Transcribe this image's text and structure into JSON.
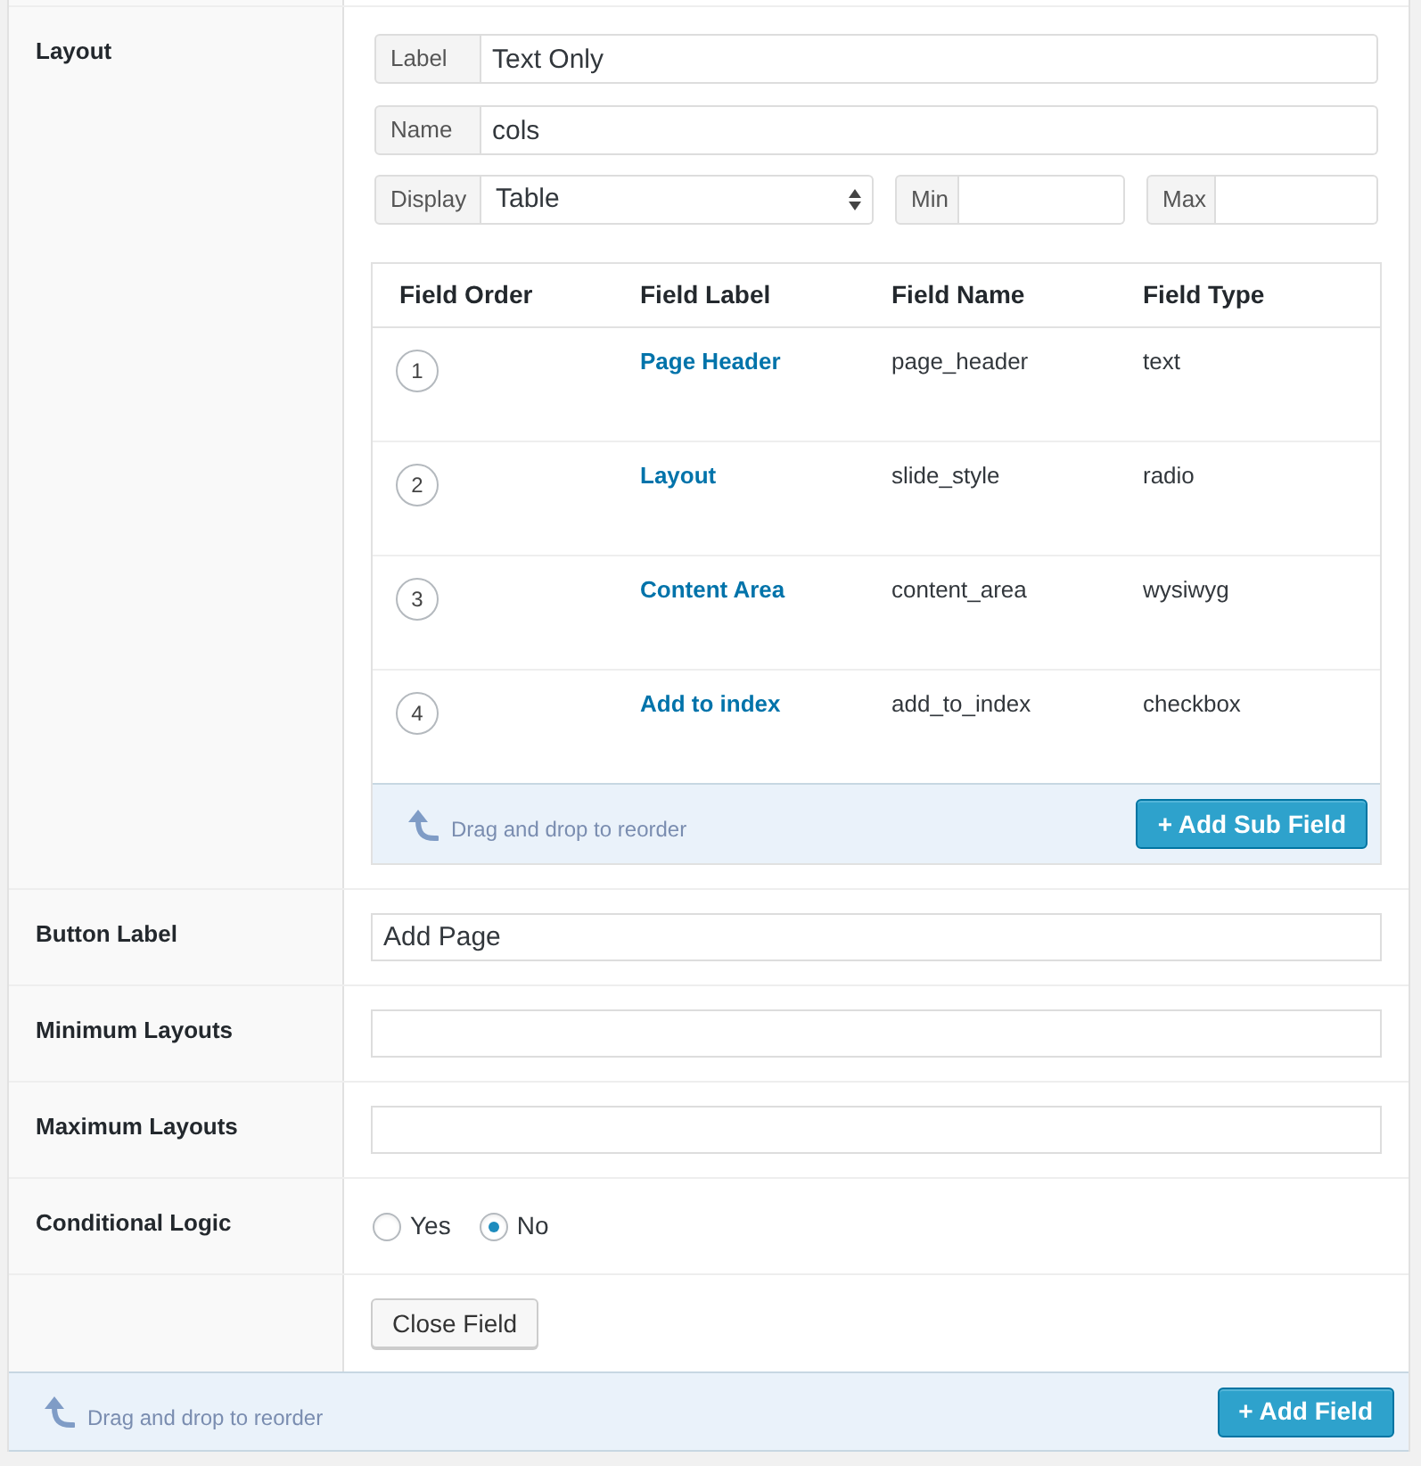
{
  "layout_field": {
    "label": "Layout",
    "inputs": [
      {
        "prefix": "Label",
        "value": "Text Only"
      },
      {
        "prefix": "Name",
        "value": "cols"
      }
    ],
    "display": {
      "prefix": "Display",
      "value": "Table"
    },
    "min": {
      "prefix": "Min"
    },
    "max": {
      "prefix": "Max"
    }
  },
  "sub_fields": {
    "columns": [
      "Field Order",
      "Field Label",
      "Field Name",
      "Field Type"
    ],
    "rows": [
      {
        "order": "1",
        "label": "Page Header",
        "name": "page_header",
        "type": "text"
      },
      {
        "order": "2",
        "label": "Layout",
        "name": "slide_style",
        "type": "radio"
      },
      {
        "order": "3",
        "label": "Content Area",
        "name": "content_area",
        "type": "wysiwyg"
      },
      {
        "order": "4",
        "label": "Add to index",
        "name": "add_to_index",
        "type": "checkbox"
      }
    ],
    "hint": "Drag and drop to reorder",
    "add_button": "+ Add Sub Field"
  },
  "settings": [
    {
      "kind": "text",
      "label": "Button Label",
      "value": "Add Page"
    },
    {
      "kind": "text",
      "label": "Minimum Layouts"
    },
    {
      "kind": "text",
      "label": "Maximum Layouts"
    },
    {
      "kind": "radio",
      "label": "Conditional Logic",
      "options": [
        {
          "label": "Yes",
          "selected": false
        },
        {
          "label": "No",
          "selected": true
        }
      ]
    },
    {
      "kind": "button",
      "button": "Close Field"
    }
  ],
  "footer": {
    "hint": "Drag and drop to reorder",
    "add_button": "+ Add Field"
  }
}
